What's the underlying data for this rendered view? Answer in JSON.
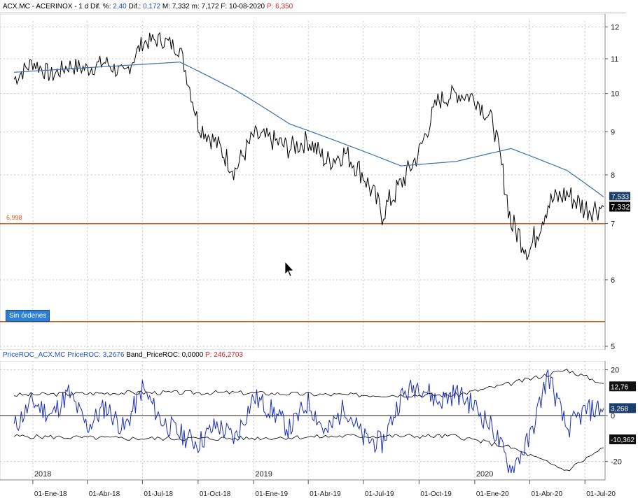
{
  "header": {
    "symbol": "ACX.MC - ACERINOX - 1 d",
    "dif_pct_label": "Dif. %:",
    "dif_pct_value": "2,40",
    "dif_label": "Dif.:",
    "dif_value": "0,172",
    "m_label": "M: 7,332",
    "min_label": "m: 7,172",
    "date_label": "F: 10-08-2020",
    "p_label": "P: 6,350"
  },
  "osc_header": {
    "name": "PriceROC_ACX.MC",
    "value_label": "PriceROC: 3,2676",
    "band_label": "Band_PriceROC: 0,0000",
    "p_label": "P: 246,2703"
  },
  "badge": "Sin órdenes",
  "hline_label": "6,998",
  "colors": {
    "price": "#000000",
    "ma": "#3a6fb0",
    "hline": "#e05a1a",
    "roc": "#1a2fb0",
    "band": "#000000",
    "last_price_bg": "#000000",
    "ma_badge_bg": "#1b3d6e"
  },
  "chart_data": [
    {
      "type": "line",
      "title": "",
      "y_axis_side": "right",
      "y_scale": "log",
      "ylim": [
        5,
        12.2
      ],
      "y_ticks": [
        5,
        6,
        7,
        8,
        9,
        10,
        11,
        12
      ],
      "y_tick_labels": [
        "5",
        "6",
        "7",
        "8",
        "9",
        "10",
        "11",
        "12"
      ],
      "horizontal_lines": [
        6.998,
        5.35
      ],
      "last_price": "7,332",
      "ma_last": "7,533",
      "x_ticks": [
        "2018-01",
        "2018-04",
        "2018-07",
        "2018-10",
        "2019-01",
        "2019-04",
        "2019-07",
        "2019-10",
        "2020-01",
        "2020-04",
        "2020-07"
      ],
      "series": [
        {
          "name": "",
          "x": [
            "2017-12",
            "2018-01",
            "2018-02",
            "2018-03",
            "2018-04",
            "2018-05",
            "2018-06",
            "2018-07",
            "2018-08",
            "2018-09",
            "2018-10",
            "2018-11",
            "2018-12",
            "2019-01",
            "2019-02",
            "2019-03",
            "2019-04",
            "2019-05",
            "2019-06",
            "2019-07",
            "2019-08",
            "2019-09",
            "2019-10",
            "2019-11",
            "2019-12",
            "2020-01",
            "2020-02",
            "2020-03",
            "2020-04",
            "2020-05",
            "2020-06",
            "2020-07",
            "2020-08"
          ],
          "values": [
            10.4,
            10.9,
            10.5,
            10.8,
            10.7,
            10.9,
            10.5,
            11.5,
            11.6,
            11.3,
            9.2,
            8.7,
            8.1,
            8.9,
            8.8,
            8.6,
            8.8,
            8.3,
            8.5,
            8.0,
            7.2,
            7.8,
            8.5,
            9.8,
            10.0,
            9.9,
            9.2,
            7.0,
            6.5,
            7.4,
            7.6,
            7.3,
            7.33
          ]
        },
        {
          "name": "",
          "x": [
            "2017-12",
            "2018-03",
            "2018-06",
            "2018-09",
            "2018-12",
            "2019-03",
            "2019-06",
            "2019-09",
            "2019-12",
            "2020-03",
            "2020-06",
            "2020-08"
          ],
          "values": [
            10.6,
            10.7,
            10.8,
            10.9,
            10.1,
            9.2,
            8.7,
            8.2,
            8.3,
            8.6,
            8.1,
            7.53
          ]
        }
      ]
    },
    {
      "type": "line",
      "title": "",
      "y_axis_side": "right",
      "ylim": [
        -25,
        22
      ],
      "y_ticks": [
        20,
        0,
        -20
      ],
      "y_tick_labels": [
        "20",
        "0",
        "-20"
      ],
      "value_badges": [
        "12,76",
        "3,268",
        "-10,362"
      ],
      "series": [
        {
          "name": "",
          "x": [
            "2017-12",
            "2018-01",
            "2018-02",
            "2018-03",
            "2018-04",
            "2018-05",
            "2018-06",
            "2018-07",
            "2018-08",
            "2018-09",
            "2018-10",
            "2018-11",
            "2018-12",
            "2019-01",
            "2019-02",
            "2019-03",
            "2019-04",
            "2019-05",
            "2019-06",
            "2019-07",
            "2019-08",
            "2019-09",
            "2019-10",
            "2019-11",
            "2019-12",
            "2020-01",
            "2020-02",
            "2020-03",
            "2020-04",
            "2020-05",
            "2020-06",
            "2020-07",
            "2020-08"
          ],
          "values": [
            -5,
            6,
            0,
            10,
            -5,
            4,
            -6,
            12,
            -2,
            -8,
            -12,
            -4,
            -10,
            8,
            2,
            -6,
            6,
            -8,
            4,
            -10,
            -12,
            8,
            14,
            6,
            10,
            4,
            -6,
            -24,
            -10,
            18,
            -6,
            2,
            3.27
          ]
        },
        {
          "name": "",
          "x": [
            "2017-12",
            "2018-06",
            "2018-12",
            "2019-06",
            "2019-12",
            "2020-03",
            "2020-06",
            "2020-08"
          ],
          "values": [
            9,
            10,
            10,
            9,
            9,
            14,
            20,
            14
          ]
        },
        {
          "name": "",
          "x": [
            "2017-12",
            "2018-06",
            "2018-12",
            "2019-06",
            "2019-12",
            "2020-03",
            "2020-06",
            "2020-08"
          ],
          "values": [
            -9,
            -10,
            -10,
            -9,
            -9,
            -14,
            -24,
            -14
          ]
        }
      ]
    }
  ],
  "x_axis": {
    "years": [
      "2018",
      "2019",
      "2020"
    ],
    "months": [
      "01-Ene-18",
      "01-Abr-18",
      "01-Jul-18",
      "01-Oct-18",
      "01-Ene-19",
      "01-Abr-19",
      "01-Jul-19",
      "01-Oct-19",
      "01-Ene-20",
      "01-Abr-20",
      "01-Jul-20"
    ]
  }
}
